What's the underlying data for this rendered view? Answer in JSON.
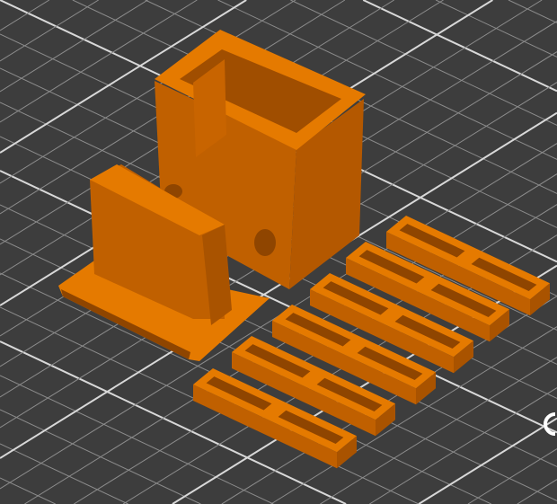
{
  "viewer": {
    "background_color": "#3d3d3d",
    "grid_color": "#8c8c8c",
    "grid_major_color": "#d8d8d8",
    "object_top_color": "#e57a00",
    "object_side_color": "#c06000",
    "object_shadow_color": "#8f4500",
    "logo_icon": "bed-logo-icon"
  }
}
